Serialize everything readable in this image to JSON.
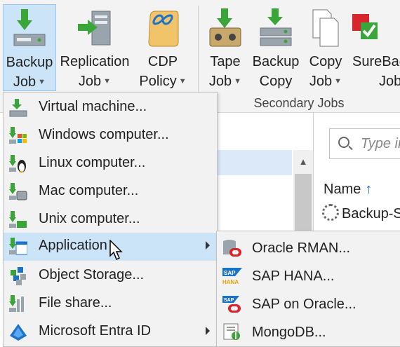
{
  "ribbon": {
    "buttons": [
      {
        "label1": "Backup",
        "label2": "Job",
        "icon": "backup-job-icon"
      },
      {
        "label1": "Replication",
        "label2": "Job",
        "icon": "replication-job-icon"
      },
      {
        "label1": "CDP",
        "label2": "Policy",
        "icon": "cdp-policy-icon"
      },
      {
        "label1": "Tape",
        "label2": "Job",
        "icon": "tape-job-icon"
      },
      {
        "label1": "Backup",
        "label2": "Copy",
        "icon": "backup-copy-icon"
      },
      {
        "label1": "Copy",
        "label2": "Job",
        "icon": "copy-job-icon"
      },
      {
        "label1": "SureBac",
        "label2": "Job",
        "icon": "surebackup-job-icon"
      }
    ],
    "group_label": "Secondary Jobs"
  },
  "menu": {
    "items": [
      {
        "label": "Virtual machine...",
        "icon": "virtual-machine-icon"
      },
      {
        "label": "Windows computer...",
        "icon": "windows-computer-icon"
      },
      {
        "label": "Linux computer...",
        "icon": "linux-computer-icon"
      },
      {
        "label": "Mac computer...",
        "icon": "mac-computer-icon"
      },
      {
        "label": "Unix computer...",
        "icon": "unix-computer-icon"
      },
      {
        "label": "Application",
        "icon": "application-icon"
      },
      {
        "label": "Object Storage...",
        "icon": "object-storage-icon"
      },
      {
        "label": "File share...",
        "icon": "file-share-icon"
      },
      {
        "label": "Microsoft Entra ID",
        "icon": "microsoft-entra-id-icon"
      }
    ]
  },
  "submenu": {
    "items": [
      {
        "label": "Oracle RMAN...",
        "icon": "oracle-rman-icon"
      },
      {
        "label": "SAP HANA...",
        "icon": "sap-hana-icon",
        "badge": "HANA"
      },
      {
        "label": "SAP on Oracle...",
        "icon": "sap-on-oracle-icon"
      },
      {
        "label": "MongoDB...",
        "icon": "mongodb-icon"
      }
    ]
  },
  "search": {
    "placeholder": "Type in"
  },
  "list": {
    "column_name": "Name",
    "sort_arrow": "↑",
    "rows": [
      "Backup-S"
    ]
  },
  "colors": {
    "accent_green": "#3aa63a",
    "highlight_blue": "#cce4f7",
    "oracle_red": "#d8262e",
    "sap_blue": "#1a73c8"
  }
}
